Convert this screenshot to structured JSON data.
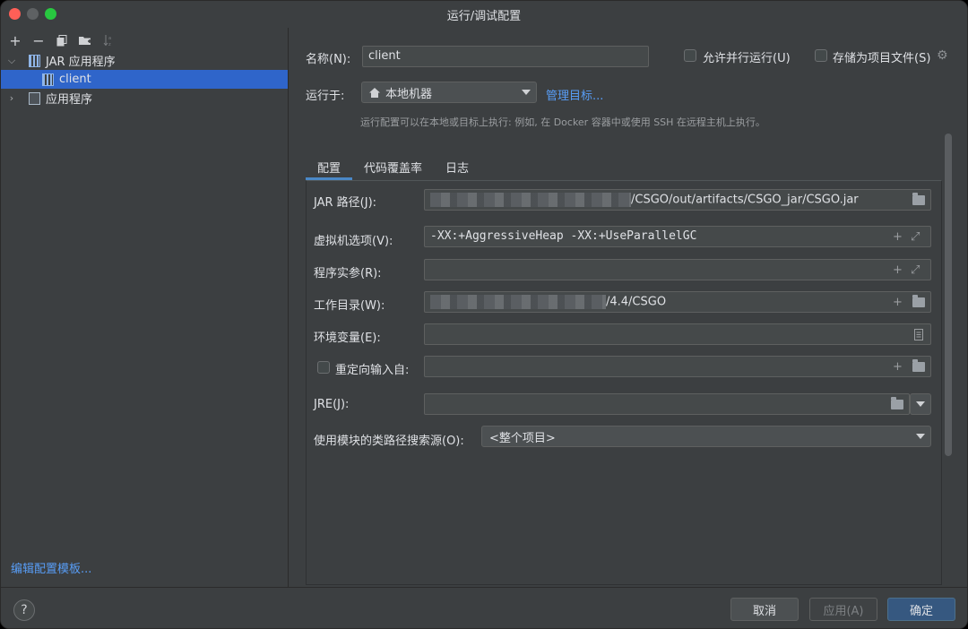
{
  "window": {
    "title": "运行/调试配置"
  },
  "sidebar": {
    "toolbar": [
      "add-icon",
      "remove-icon",
      "copy-icon",
      "folder-add-icon",
      "sort-icon"
    ],
    "tree": [
      {
        "label": "JAR 应用程序",
        "expanded": true,
        "icon": "jar-icon"
      },
      {
        "label": "client",
        "selected": true,
        "icon": "jar-icon"
      },
      {
        "label": "应用程序",
        "expanded": false,
        "icon": "app-icon"
      }
    ],
    "edit_templates": "编辑配置模板..."
  },
  "form": {
    "name_label": "名称(N):",
    "name_value": "client",
    "allow_parallel": "允许并行运行(U)",
    "store_as_file": "存储为项目文件(S)",
    "run_on_label": "运行于:",
    "run_on_value": "本地机器",
    "manage_targets": "管理目标...",
    "hint": "运行配置可以在本地或目标上执行: 例如, 在 Docker 容器中或使用 SSH 在远程主机上执行。"
  },
  "tabs": [
    "配置",
    "代码覆盖率",
    "日志"
  ],
  "config": {
    "jar_path_label": "JAR 路径(J):",
    "jar_path_value": "/CSGO/out/artifacts/CSGO_jar/CSGO.jar",
    "vm_options_label": "虚拟机选项(V):",
    "vm_options_value": "-XX:+AggressiveHeap -XX:+UseParallelGC",
    "program_args_label": "程序实参(R):",
    "program_args_value": "",
    "work_dir_label": "工作目录(W):",
    "work_dir_value": "/4.4/CSGO",
    "env_label": "环境变量(E):",
    "env_value": "",
    "redirect_label": "重定向输入自:",
    "redirect_value": "",
    "jre_label": "JRE(J):",
    "jre_value": "",
    "module_cp_label": "使用模块的类路径搜索源(O):",
    "module_cp_value": "<整个项目>"
  },
  "footer": {
    "help": "?",
    "cancel": "取消",
    "apply": "应用(A)",
    "ok": "确定"
  },
  "colors": {
    "selection": "#2f65ca",
    "link": "#589df6",
    "primary_button": "#365880"
  }
}
